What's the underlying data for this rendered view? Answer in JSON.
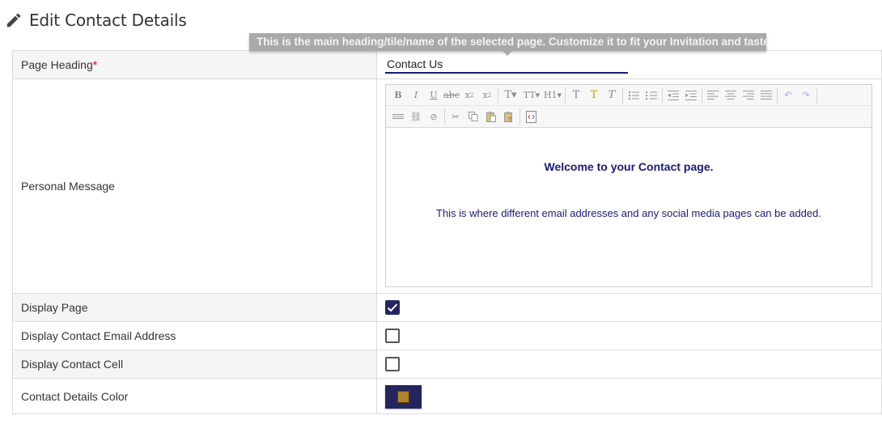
{
  "header": {
    "title": "Edit Contact Details",
    "icon": "pencil-icon"
  },
  "tooltip": {
    "text": "This is the main heading/tile/name of the selected page. Customize it to fit your Invitation and taste."
  },
  "form": {
    "page_heading": {
      "label": "Page Heading",
      "required_mark": "*",
      "value": "Contact Us"
    },
    "personal_message": {
      "label": "Personal Message",
      "content_line1": "Welcome to your Contact page.",
      "content_line2": "This is where different email addresses and any social media pages can be added.",
      "toolbar_row1": [
        "bold-icon",
        "italic-icon",
        "underline-icon",
        "strikethrough-icon",
        "subscript-icon",
        "superscript-icon",
        "font-size-icon",
        "font-name-icon",
        "heading-icon",
        "font-color-icon",
        "highlight-icon",
        "clear-format-icon",
        "bulleted-list-icon",
        "numbered-list-icon",
        "outdent-icon",
        "indent-icon",
        "align-left-icon",
        "align-center-icon",
        "align-right-icon",
        "justify-icon",
        "undo-icon",
        "redo-icon"
      ],
      "toolbar_row2": [
        "horizontal-rule-icon",
        "link-icon",
        "unlink-icon",
        "cut-icon",
        "copy-icon",
        "paste-icon",
        "paste-text-icon",
        "source-code-icon"
      ]
    },
    "display_page": {
      "label": "Display Page",
      "checked": true
    },
    "display_contact_email": {
      "label": "Display Contact Email Address",
      "checked": false
    },
    "display_contact_cell": {
      "label": "Display Contact Cell",
      "checked": false
    },
    "contact_details_color": {
      "label": "Contact Details Color",
      "color": "#b0812a"
    }
  },
  "colors": {
    "accent": "#25255e",
    "editor_text": "#1a1a7a",
    "required": "#d0021b"
  }
}
